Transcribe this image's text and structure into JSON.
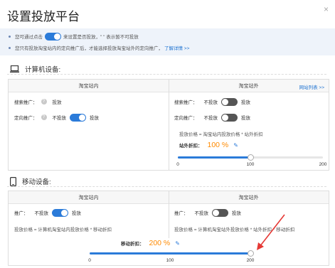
{
  "dialog": {
    "title": "设置投放平台",
    "close_icon": "×"
  },
  "notice": {
    "line1_pre": "您可通过点击",
    "line1_post": "来设置是否投放，\"  \" 表示暂不可投放",
    "line2": "您只有投放淘宝站内的定向推广后，才能选择投放淘宝站外的定向推广，",
    "line2_link": "了解详情 >>"
  },
  "computer": {
    "heading": "计算机设备:",
    "inner_header": "淘宝站内",
    "outer_header": "淘宝站外",
    "site_list_link": "网站列表 >>",
    "search_label": "搜索推广：",
    "search_value": "投放",
    "targeted_label": "定向推广：",
    "targeted_off": "不投放",
    "targeted_on": "投放",
    "outer_search_label": "搜索推广：",
    "outer_search_off": "不投放",
    "outer_search_on": "投放",
    "outer_targeted_label": "定向推广：",
    "outer_targeted_off": "不投放",
    "outer_targeted_on": "投放",
    "formula": "投放价格 = 淘宝站内投放价格 * 站外折扣",
    "discount_label": "站外折扣：",
    "discount_value": "100 %",
    "slider": {
      "value": 100,
      "min": 0,
      "max": 200,
      "ticks": [
        "0",
        "100",
        "200"
      ]
    }
  },
  "mobile": {
    "heading": "移动设备:",
    "inner_header": "淘宝站内",
    "outer_header": "淘宝站外",
    "inner_label": "推广：",
    "inner_off": "不投放",
    "inner_on": "投放",
    "outer_label": "推广：",
    "outer_off": "不投放",
    "outer_on": "投放",
    "inner_formula": "投放价格 = 计算机淘宝站内投放价格 * 移动折扣",
    "outer_formula": "投放价格 = 计算机淘宝站外投放价格 * 站外折扣 * 移动折扣",
    "discount_label": "移动折扣：",
    "discount_value": "200 %",
    "slider": {
      "value": 200,
      "min": 0,
      "max": 200,
      "ticks": [
        "0",
        "100",
        "200"
      ]
    }
  },
  "colors": {
    "accent": "#2b7bd9",
    "highlight": "#ff8a00",
    "annotation": "#e53935"
  }
}
